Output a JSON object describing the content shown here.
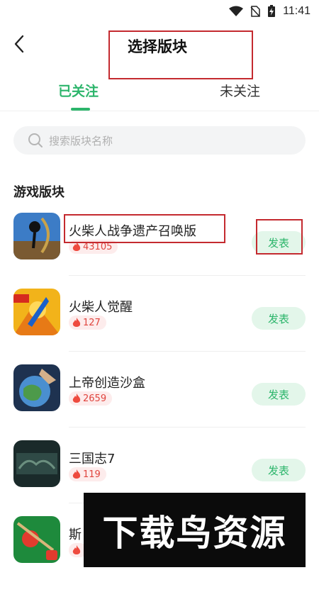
{
  "status": {
    "time": "11:41"
  },
  "header": {
    "title": "选择版块"
  },
  "tabs": [
    {
      "label": "已关注",
      "active": true
    },
    {
      "label": "未关注",
      "active": false
    }
  ],
  "search": {
    "placeholder": "搜索版块名称"
  },
  "section": {
    "title": "游戏版块"
  },
  "items": [
    {
      "name": "火柴人战争遗产召唤版",
      "heat": "43105",
      "button": "发表"
    },
    {
      "name": "火柴人觉醒",
      "heat": "127",
      "button": "发表"
    },
    {
      "name": "上帝创造沙盒",
      "heat": "2659",
      "button": "发表"
    },
    {
      "name": "三国志7",
      "heat": "119",
      "button": "发表"
    },
    {
      "name": "斯",
      "heat": "",
      "button": ""
    }
  ],
  "watermark": {
    "text": "下载鸟资源"
  },
  "colors": {
    "accent": "#2cb56b",
    "heat": "#e0453e",
    "annotation": "#c42a2f"
  }
}
